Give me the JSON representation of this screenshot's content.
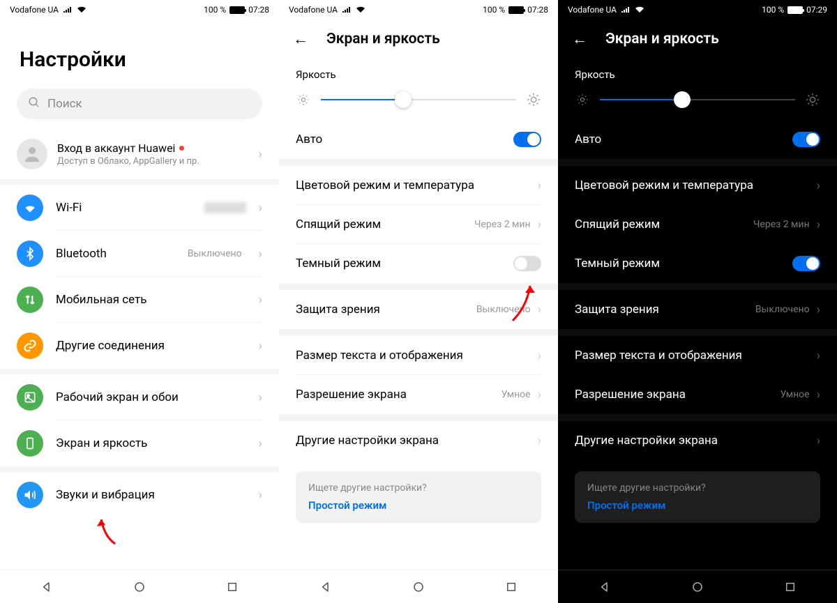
{
  "statusbar": {
    "carrier": "Vodafone UA",
    "battery": "100 %",
    "time1": "07:28",
    "time2": "07:29"
  },
  "screen1": {
    "title": "Настройки",
    "search_placeholder": "Поиск",
    "account": {
      "title": "Вход в аккаунт Huawei",
      "subtitle": "Доступ в Облако, AppGallery и пр."
    },
    "items": [
      {
        "icon": "wifi",
        "color": "#1e90ff",
        "label": "Wi-Fi",
        "value": ""
      },
      {
        "icon": "bluetooth",
        "color": "#1e90ff",
        "label": "Bluetooth",
        "value": "Выключено"
      },
      {
        "icon": "mobile",
        "color": "#4caf50",
        "label": "Мобильная сеть",
        "value": ""
      },
      {
        "icon": "link",
        "color": "#ff9800",
        "label": "Другие соединения",
        "value": ""
      },
      {
        "icon": "desktop",
        "color": "#4caf50",
        "label": "Рабочий экран и обои",
        "value": ""
      },
      {
        "icon": "screen",
        "color": "#4caf50",
        "label": "Экран и яркость",
        "value": ""
      },
      {
        "icon": "sound",
        "color": "#2196f3",
        "label": "Звуки и вибрация",
        "value": ""
      }
    ]
  },
  "screen23": {
    "header": "Экран и яркость",
    "brightness_label": "Яркость",
    "auto_label": "Авто",
    "rows": {
      "color_mode": {
        "label": "Цветовой режим и температура",
        "value": ""
      },
      "sleep": {
        "label": "Спящий режим",
        "value": "Через 2 мин"
      },
      "dark_mode": {
        "label": "Темный режим",
        "value": ""
      },
      "eye": {
        "label": "Защита зрения",
        "value": "Выключено"
      },
      "text_size": {
        "label": "Размер текста и отображения",
        "value": ""
      },
      "resolution": {
        "label": "Разрешение экрана",
        "value": "Умное"
      },
      "other": {
        "label": "Другие настройки экрана",
        "value": ""
      }
    },
    "hint": {
      "question": "Ищете другие настройки?",
      "link": "Простой режим"
    }
  }
}
